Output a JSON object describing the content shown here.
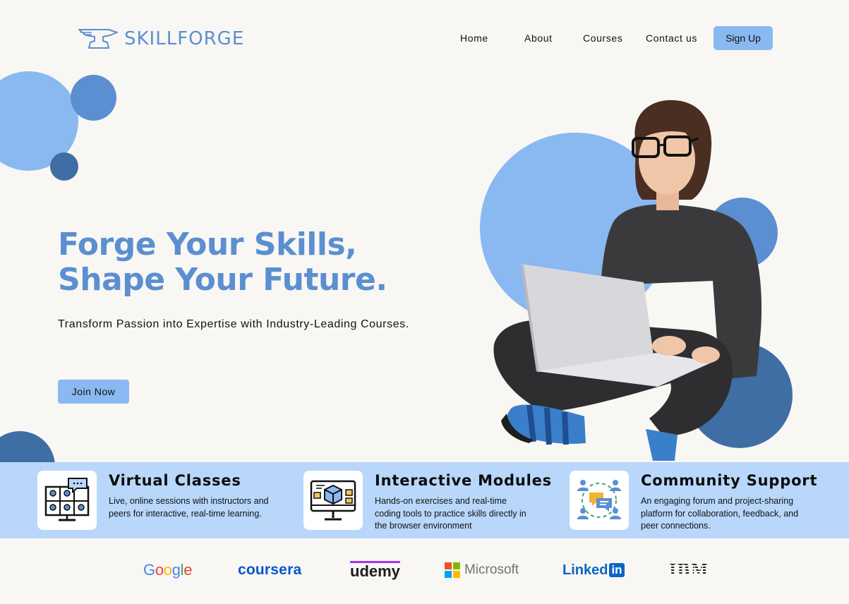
{
  "brand": {
    "name": "SKILLFORGE",
    "color": "#5b8fd1",
    "logo_icon": "anvil-icon"
  },
  "nav": {
    "items": [
      {
        "label": "Home"
      },
      {
        "label": "About"
      },
      {
        "label": "Courses"
      },
      {
        "label": "Contact us"
      }
    ],
    "signup_label": "Sign Up"
  },
  "hero": {
    "title_line1": "Forge Your Skills,",
    "title_line2": "Shape Your Future.",
    "subtitle": "Transform Passion into Expertise with Industry-Leading Courses.",
    "cta_label": "Join Now",
    "image": "student-with-laptop"
  },
  "features": [
    {
      "icon": "video-conference-icon",
      "title": "Virtual Classes",
      "desc_line1": "Live, online sessions with instructors and",
      "desc_line2": "peers for interactive, real-time learning.",
      "desc_line3": ""
    },
    {
      "icon": "interactive-module-icon",
      "title": "Interactive Modules",
      "desc_line1": "Hands-on exercises and real-time",
      "desc_line2": "coding tools to practice skills directly in",
      "desc_line3": "the browser environment"
    },
    {
      "icon": "community-chat-icon",
      "title": "Community Support",
      "desc_line1": "An engaging forum and project-sharing",
      "desc_line2": "platform for collaboration, feedback, and",
      "desc_line3": "peer connections."
    }
  ],
  "partners": [
    {
      "name": "Google"
    },
    {
      "name": "coursera"
    },
    {
      "name": "udemy"
    },
    {
      "name": "Microsoft"
    },
    {
      "name": "Linked",
      "suffix": "in"
    },
    {
      "name": "IBM"
    }
  ],
  "colors": {
    "accent": "#5b8fd1",
    "light_accent": "#8ab9f1",
    "band": "#b8d7fb",
    "dark_circle": "#3f6ea5",
    "background": "#f9f7f4"
  }
}
